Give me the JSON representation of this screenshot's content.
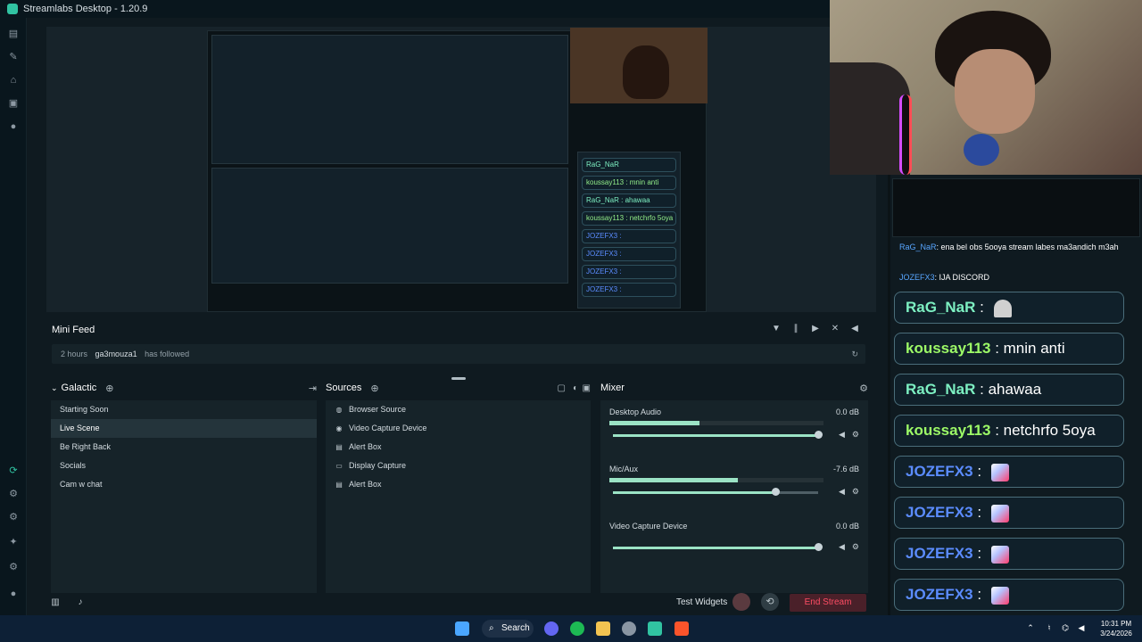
{
  "window": {
    "title": "Streamlabs Desktop - 1.20.9"
  },
  "minifeed": {
    "title": "Mini Feed",
    "event": {
      "time": "2 hours",
      "user": "ga3mouza1",
      "action": "has followed"
    }
  },
  "scenes": {
    "title": "Galactic",
    "items": [
      "Starting Soon",
      "Live Scene",
      "Be Right Back",
      "Socials",
      "Cam w chat"
    ],
    "active": "Live Scene"
  },
  "sources": {
    "title": "Sources",
    "items": [
      {
        "label": "Browser Source",
        "icon": "globe-icon"
      },
      {
        "label": "Video Capture Device",
        "icon": "camera-icon"
      },
      {
        "label": "Alert Box",
        "icon": "alert-box-icon"
      },
      {
        "label": "Display Capture",
        "icon": "monitor-icon"
      },
      {
        "label": "Alert Box",
        "icon": "alert-box-icon"
      }
    ]
  },
  "mixer": {
    "title": "Mixer",
    "items": [
      {
        "name": "Desktop Audio",
        "db": "0.0 dB",
        "meter_level": 0.42,
        "volume": 1.0
      },
      {
        "name": "Mic/Aux",
        "db": "-7.6 dB",
        "meter_level": 0.6,
        "volume": 0.79
      },
      {
        "name": "Video Capture Device",
        "db": "0.0 dB",
        "meter_level": 0.0,
        "volume": 1.0
      }
    ]
  },
  "footer": {
    "test_widgets": "Test Widgets",
    "end_stream": "End Stream"
  },
  "chat": {
    "line1": {
      "nick": "RaG_NaR",
      "text": "ena bel obs 5ooya stream labes ma3andich m3ah"
    },
    "line2": {
      "nick": "JOZEFX3",
      "text": "IJA DISCORD"
    },
    "messages": [
      {
        "nick": "RaG_NaR",
        "text": "",
        "style": "teal",
        "emote": "ghost"
      },
      {
        "nick": "koussay113",
        "text": "mnin anti",
        "style": "green"
      },
      {
        "nick": "RaG_NaR",
        "text": "ahawaa",
        "style": "teal"
      },
      {
        "nick": "koussay113",
        "text": "netchrfo 5oya",
        "style": "green"
      },
      {
        "nick": "JOZEFX3",
        "text": "",
        "style": "blue",
        "emote": "anime"
      },
      {
        "nick": "JOZEFX3",
        "text": "",
        "style": "blue",
        "emote": "anime"
      },
      {
        "nick": "JOZEFX3",
        "text": "",
        "style": "blue",
        "emote": "anime"
      },
      {
        "nick": "JOZEFX3",
        "text": "",
        "style": "blue",
        "emote": "anime"
      }
    ]
  },
  "taskbar": {
    "search": "Search",
    "time": "10:31 PM",
    "date": "3/24/2026"
  },
  "colors": {
    "accent": "#31c3a2",
    "end_stream": "#ff4d64",
    "meter": "#9be3c5"
  }
}
